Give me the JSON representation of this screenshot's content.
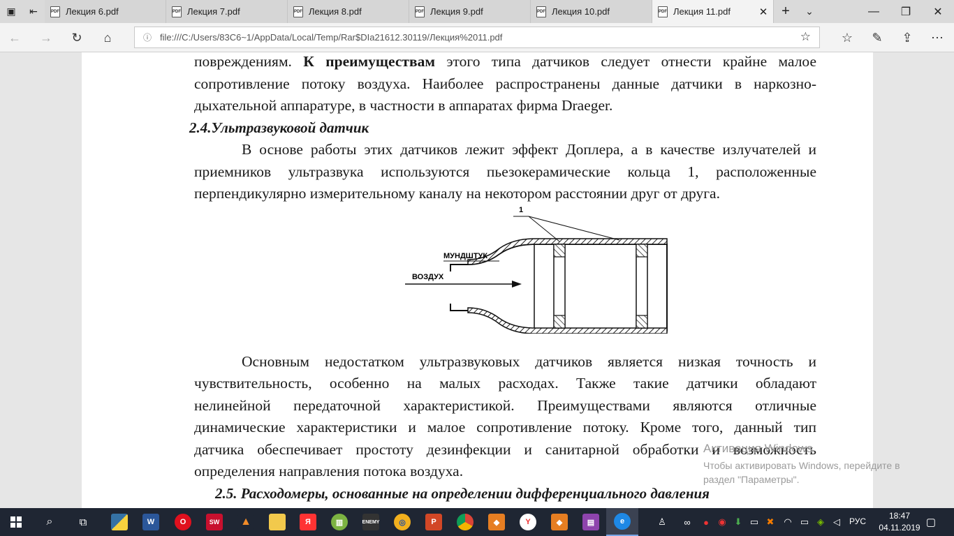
{
  "browser": {
    "tabs": [
      {
        "label": "Лекция 6.pdf"
      },
      {
        "label": "Лекция 7.pdf"
      },
      {
        "label": "Лекция 8.pdf"
      },
      {
        "label": "Лекция 9.pdf"
      },
      {
        "label": "Лекция 10.pdf"
      },
      {
        "label": "Лекция 11.pdf",
        "active": true
      }
    ],
    "pdf_badge": "PDF",
    "address": "file:///C:/Users/83C6~1/AppData/Local/Temp/Rar$DIa21612.30119/Лекция%2011.pdf"
  },
  "document": {
    "para1": {
      "line1_a": "повреждениям. ",
      "line1_bold": "К преимуществам",
      "line1_b": " этого типа датчиков следует отнести крайне малое",
      "line2": "сопротивление потоку воздуха. Наиболее распространены данные датчики в наркозно-",
      "line3": "дыхательной аппаратуре, в частности в аппаратах фирма Draeger."
    },
    "heading_24": "2.4.Ультразвуковой датчик",
    "para2": [
      "В основе работы этих датчиков лежит эффект Доплера, а в качестве излучателей и",
      "приемников ультразвука используются пьезокерамические кольца 1, расположенные",
      "перпендикулярно измерительному каналу на некотором расстоянии друг от друга."
    ],
    "figure": {
      "label_1": "1",
      "label_mouthpiece": "МУНДШТУК",
      "label_air": "ВОЗДУХ"
    },
    "para3": [
      "Основным недостатком ультразвуковых датчиков является низкая точность и",
      "чувствительность, особенно на малых расходах. Также такие датчики обладают",
      "нелинейной передаточной характеристикой. Преимуществами являются отличные",
      "динамические характеристики и малое сопротивление потоку. Кроме того, данный тип",
      "датчика обеспечивает простоту дезинфекции и санитарной обработки и возможность",
      "определения направления потока воздуха."
    ],
    "heading_25": "2.5. Расходомеры, основанные на определении дифференциального давления"
  },
  "watermark": {
    "title": "Активация Windows",
    "line1": "Чтобы активировать Windows, перейдите в",
    "line2": "раздел \"Параметры\"."
  },
  "taskbar": {
    "lang": "РУС",
    "time": "18:47",
    "date": "04.11.2019"
  }
}
